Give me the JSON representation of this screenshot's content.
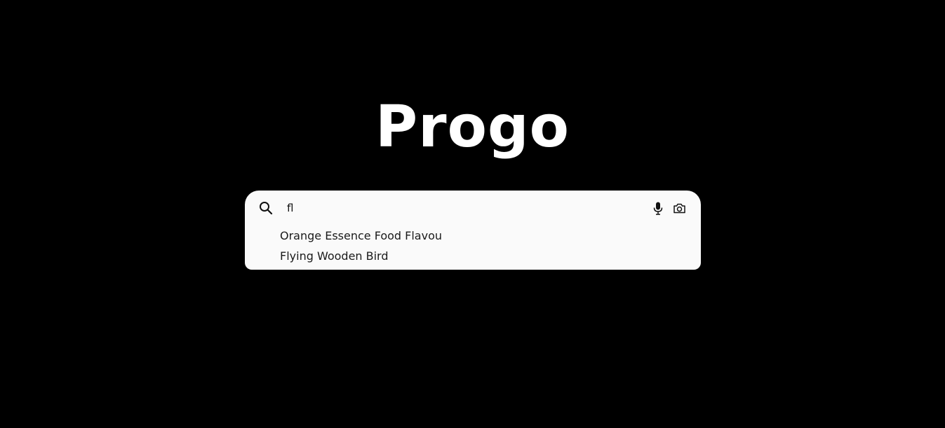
{
  "logo": {
    "text": "Progo"
  },
  "search": {
    "value": "fl",
    "placeholder": "",
    "icons": {
      "search": "search-icon",
      "voice": "mic-icon",
      "image": "camera-icon"
    }
  },
  "suggestions": [
    {
      "label": "Orange Essence Food Flavou"
    },
    {
      "label": "Flying Wooden Bird"
    }
  ],
  "colors": {
    "background": "#000000",
    "logo": "#ffffff",
    "search_box": "#fafafa",
    "text": "#1a1a1a"
  }
}
